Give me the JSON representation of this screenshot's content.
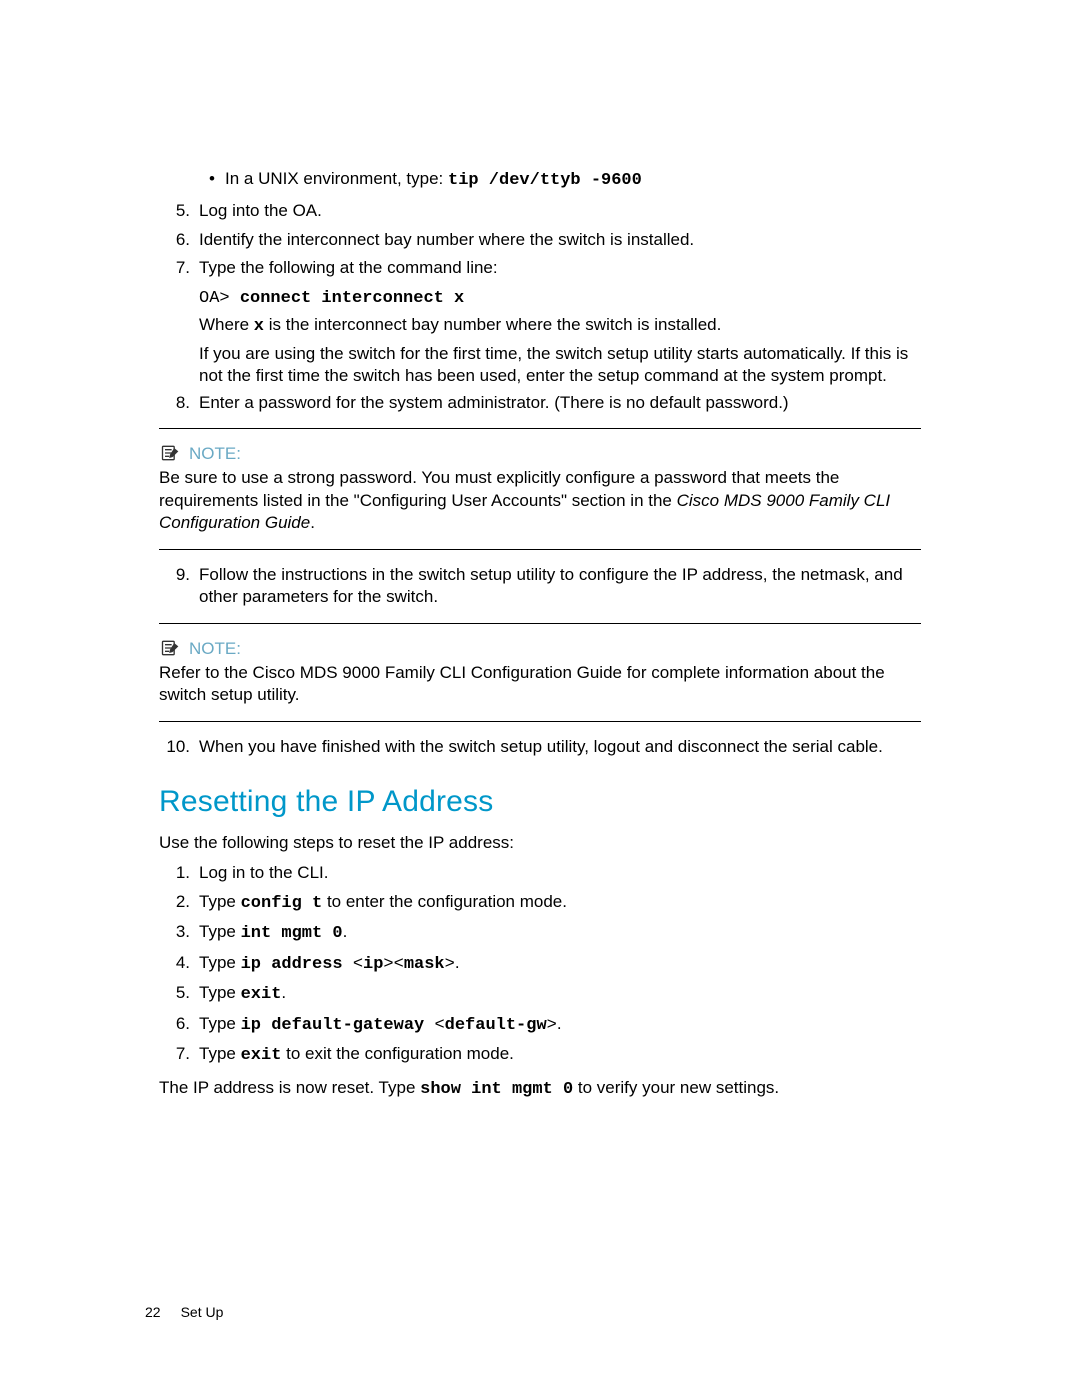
{
  "top_bullet": {
    "prefix": "In a UNIX environment, type: ",
    "cmd": "tip /dev/ttyb -9600"
  },
  "steps_a": {
    "s5": "Log into the OA.",
    "s6": "Identify the interconnect bay number where the switch is installed.",
    "s7": {
      "lead": "Type the following at the command line:",
      "cmd_prefix": "OA> ",
      "cmd": "connect interconnect x",
      "where_a": "Where ",
      "where_x": "x",
      "where_b": " is the interconnect bay number where the switch is installed.",
      "para2": "If you are using the switch for the first time, the switch setup utility starts automatically. If this is not the first time the switch has been used, enter the setup command at the system prompt."
    },
    "s8": "Enter a password for the system administrator. (There is no default password.)"
  },
  "note1": {
    "label": "NOTE:",
    "body_a": "Be sure to use a strong password. You must explicitly configure a password that meets the requirements listed in the \"Configuring User Accounts\" section in the ",
    "body_i": "Cisco MDS 9000 Family CLI Configuration Guide",
    "body_b": "."
  },
  "steps_b": {
    "s9": "Follow the instructions in the switch setup utility to configure the IP address, the netmask, and other parameters for the switch."
  },
  "note2": {
    "label": "NOTE:",
    "body": "Refer to the Cisco MDS 9000 Family CLI Configuration Guide for complete information about the switch setup utility."
  },
  "steps_c": {
    "s10": "When you have finished with the switch setup utility, logout and disconnect the serial cable."
  },
  "section_heading": "Resetting the IP Address",
  "reset_intro": "Use the following steps to reset the IP address:",
  "reset_steps": {
    "s1": "Log in to the CLI.",
    "s2_a": "Type ",
    "s2_cmd": "config t",
    "s2_b": " to enter the configuration mode.",
    "s3_a": "Type ",
    "s3_cmd": "int mgmt 0",
    "s3_b": ".",
    "s4_a": "Type ",
    "s4_cmd1": "ip address ",
    "s4_lt1": "<",
    "s4_ip": "ip",
    "s4_gt1": "><",
    "s4_mask": "mask",
    "s4_gt2": ">",
    "s4_b": ".",
    "s5_a": "Type ",
    "s5_cmd": "exit",
    "s5_b": ".",
    "s6_a": "Type ",
    "s6_cmd1": "ip default-gateway ",
    "s6_lt": "<",
    "s6_val": "default-gw",
    "s6_gt": ">",
    "s6_b": ".",
    "s7_a": "Type ",
    "s7_cmd": "exit",
    "s7_b": " to exit the configuration mode."
  },
  "reset_outro_a": "The IP address is now reset. Type ",
  "reset_outro_cmd": "show int mgmt 0",
  "reset_outro_b": " to verify your new settings.",
  "footer": {
    "page": "22",
    "chapter": "Set Up"
  },
  "nums": {
    "n5": "5.",
    "n6": "6.",
    "n7": "7.",
    "n8": "8.",
    "n9": "9.",
    "n10": "10.",
    "r1": "1.",
    "r2": "2.",
    "r3": "3.",
    "r4": "4.",
    "r5": "5.",
    "r6": "6.",
    "r7": "7."
  }
}
